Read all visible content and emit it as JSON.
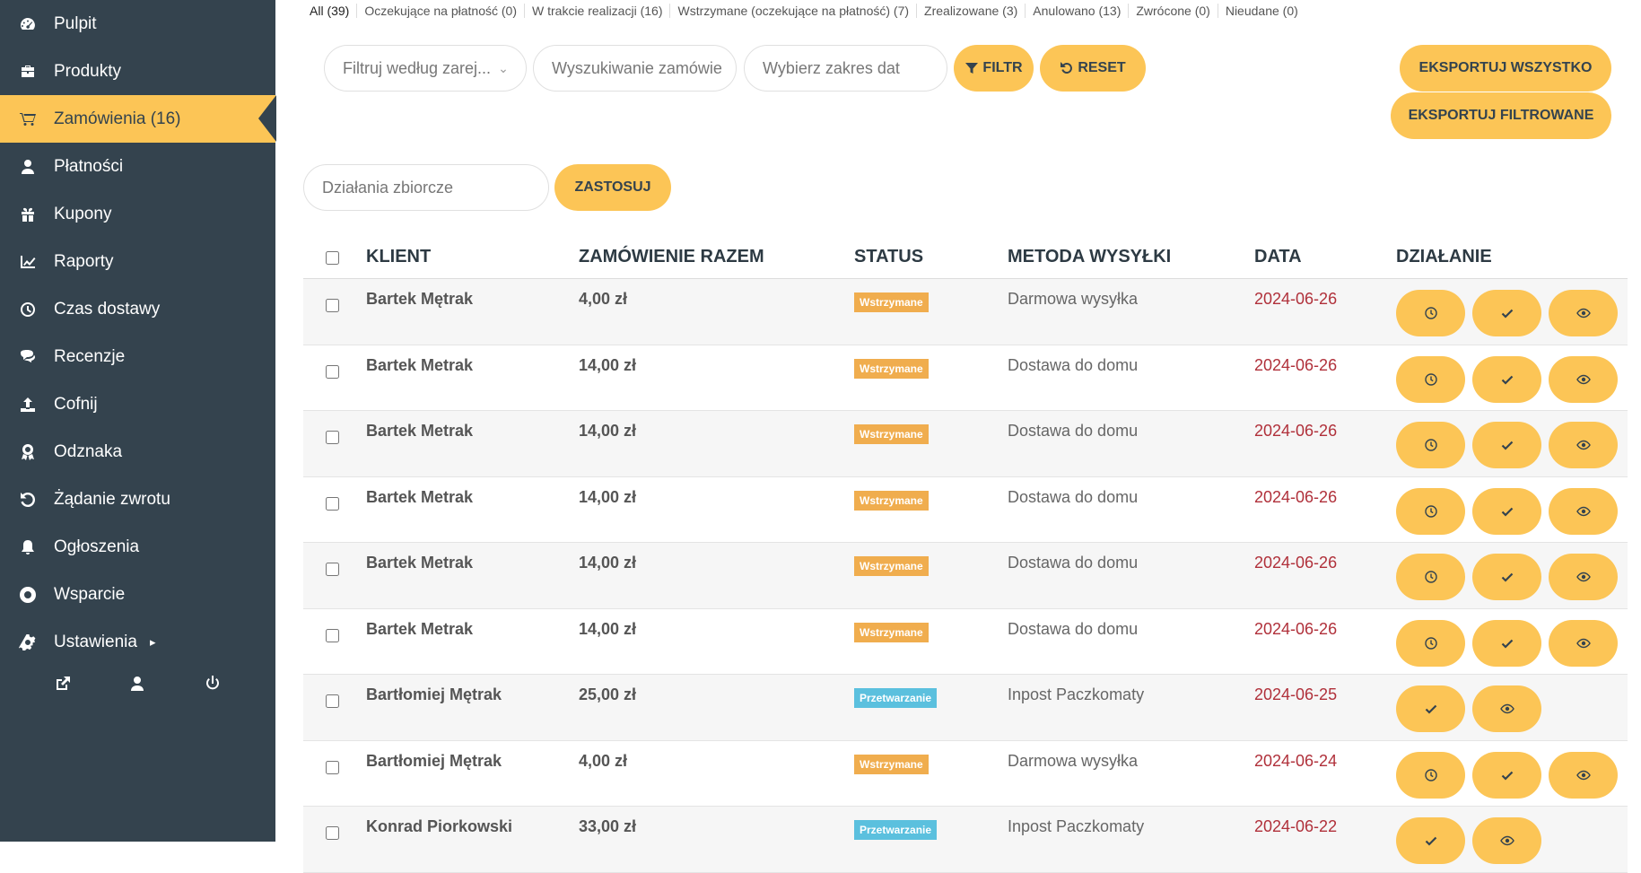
{
  "sidebar": {
    "items": [
      {
        "label": "Pulpit",
        "icon": "dashboard-icon"
      },
      {
        "label": "Produkty",
        "icon": "briefcase-icon"
      },
      {
        "label": "Zamówienia (16)",
        "icon": "cart-icon",
        "active": true
      },
      {
        "label": "Płatności",
        "icon": "user-icon"
      },
      {
        "label": "Kupony",
        "icon": "gift-icon"
      },
      {
        "label": "Raporty",
        "icon": "chart-icon"
      },
      {
        "label": "Czas dostawy",
        "icon": "clock-icon"
      },
      {
        "label": "Recenzje",
        "icon": "comments-icon"
      },
      {
        "label": "Cofnij",
        "icon": "upload-icon"
      },
      {
        "label": "Odznaka",
        "icon": "award-icon"
      },
      {
        "label": "Żądanie zwrotu",
        "icon": "undo-icon"
      },
      {
        "label": "Ogłoszenia",
        "icon": "bell-icon"
      },
      {
        "label": "Wsparcie",
        "icon": "lifebuoy-icon"
      },
      {
        "label": "Ustawienia",
        "icon": "gear-icon",
        "caret": "▸"
      }
    ],
    "bottom_icons": [
      "external-link-icon",
      "user-icon",
      "power-icon"
    ]
  },
  "tabs": [
    "All (39)",
    "Oczekujące na płatność (0)",
    "W trakcie realizacji (16)",
    "Wstrzymane (oczekujące na płatność) (7)",
    "Zrealizowane (3)",
    "Anulowano (13)",
    "Zwrócone (0)",
    "Nieudane (0)"
  ],
  "filters": {
    "customer_placeholder": "Filtruj według zarej...",
    "search_placeholder": "Wyszukiwanie zamówie",
    "date_placeholder": "Wybierz zakres dat",
    "filter_label": "FILTR",
    "reset_label": "RESET",
    "export_all_label": "EKSPORTUJ WSZYSTKO",
    "export_filtered_label": "EKSPORTUJ FILTROWANE",
    "bulk_placeholder": "Działania zbiorcze",
    "apply_label": "ZASTOSUJ"
  },
  "table": {
    "headers": {
      "client": "KLIENT",
      "total": "ZAMÓWIENIE RAZEM",
      "status": "STATUS",
      "shipping": "METODA WYSYŁKI",
      "date": "DATA",
      "action": "DZIAŁANIE"
    },
    "rows": [
      {
        "client": "Bartek Mętrak",
        "total": "4,00 zł",
        "status": "Wstrzymane",
        "shipping": "Darmowa wysyłka",
        "date": "2024-06-26",
        "actions": [
          "clock",
          "check",
          "eye"
        ]
      },
      {
        "client": "Bartek Metrak",
        "total": "14,00 zł",
        "status": "Wstrzymane",
        "shipping": "Dostawa do domu",
        "date": "2024-06-26",
        "actions": [
          "clock",
          "check",
          "eye"
        ]
      },
      {
        "client": "Bartek Metrak",
        "total": "14,00 zł",
        "status": "Wstrzymane",
        "shipping": "Dostawa do domu",
        "date": "2024-06-26",
        "actions": [
          "clock",
          "check",
          "eye"
        ]
      },
      {
        "client": "Bartek Metrak",
        "total": "14,00 zł",
        "status": "Wstrzymane",
        "shipping": "Dostawa do domu",
        "date": "2024-06-26",
        "actions": [
          "clock",
          "check",
          "eye"
        ]
      },
      {
        "client": "Bartek Metrak",
        "total": "14,00 zł",
        "status": "Wstrzymane",
        "shipping": "Dostawa do domu",
        "date": "2024-06-26",
        "actions": [
          "clock",
          "check",
          "eye"
        ]
      },
      {
        "client": "Bartek Metrak",
        "total": "14,00 zł",
        "status": "Wstrzymane",
        "shipping": "Dostawa do domu",
        "date": "2024-06-26",
        "actions": [
          "clock",
          "check",
          "eye"
        ]
      },
      {
        "client": "Bartłomiej Mętrak",
        "total": "25,00 zł",
        "status": "Przetwarzanie",
        "shipping": "Inpost Paczkomaty",
        "date": "2024-06-25",
        "actions": [
          "check",
          "eye"
        ]
      },
      {
        "client": "Bartłomiej Mętrak",
        "total": "4,00 zł",
        "status": "Wstrzymane",
        "shipping": "Darmowa wysyłka",
        "date": "2024-06-24",
        "actions": [
          "clock",
          "check",
          "eye"
        ]
      },
      {
        "client": "Konrad Piorkowski",
        "total": "33,00 zł",
        "status": "Przetwarzanie",
        "shipping": "Inpost Paczkomaty",
        "date": "2024-06-22",
        "actions": [
          "check",
          "eye"
        ]
      }
    ]
  },
  "colors": {
    "sidebar_bg": "#34434e",
    "accent": "#fcc556",
    "status_on_hold": "#f0ad4e",
    "status_processing": "#5bc0de",
    "date_text": "#b0303a"
  }
}
